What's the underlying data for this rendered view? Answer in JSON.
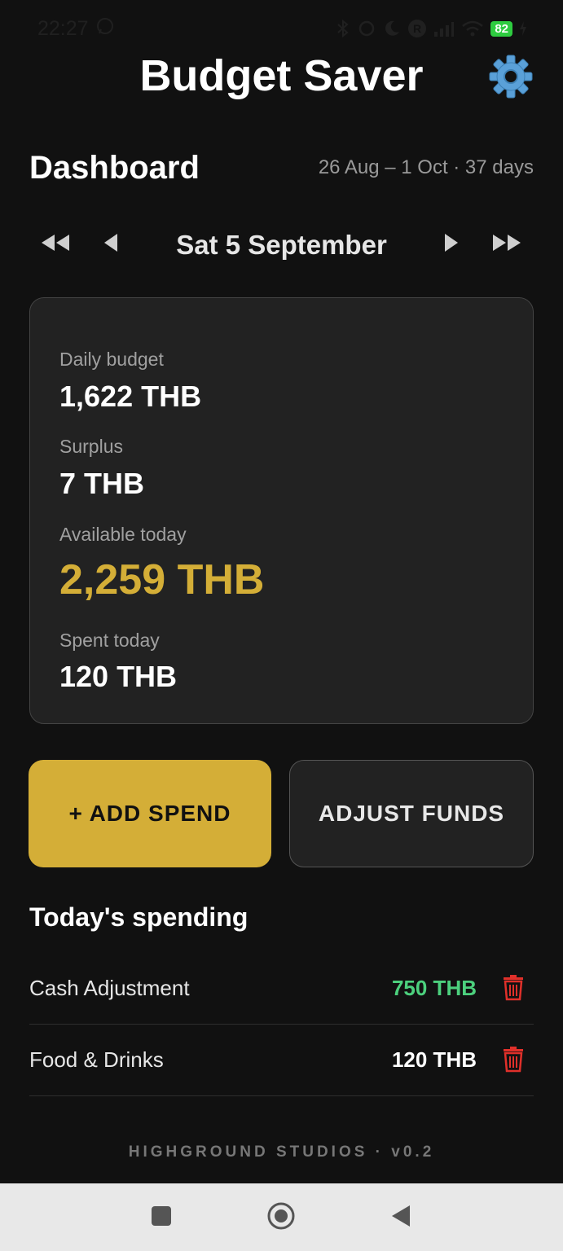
{
  "status_bar": {
    "time": "22:27",
    "battery": "82",
    "icons": [
      "whatsapp-icon",
      "bluetooth-icon",
      "link-icon",
      "moon-icon",
      "r-icon",
      "signal-icon",
      "wifi-icon",
      "charging-icon"
    ]
  },
  "header": {
    "title": "Budget Saver",
    "settings_icon": "gear-icon"
  },
  "dashboard": {
    "title": "Dashboard",
    "date_range": "26 Aug – 1 Oct · 37 days"
  },
  "date_nav": {
    "current_date": "Sat 5 September",
    "icons": [
      "double-chevron-left-icon",
      "chevron-left-icon",
      "chevron-right-icon",
      "double-chevron-right-icon"
    ]
  },
  "summary": {
    "daily_budget_label": "Daily budget",
    "daily_budget_value": "1,622 THB",
    "surplus_label": "Surplus",
    "surplus_value": "7 THB",
    "available_label": "Available today",
    "available_value": "2,259 THB",
    "spent_label": "Spent today",
    "spent_value": "120 THB"
  },
  "actions": {
    "add_spend": "+ ADD SPEND",
    "adjust_funds": "ADJUST FUNDS"
  },
  "spending": {
    "title": "Today's spending",
    "items": [
      {
        "name": "Cash Adjustment",
        "amount": "750 THB",
        "type": "positive"
      },
      {
        "name": "Food & Drinks",
        "amount": "120 THB",
        "type": "normal"
      }
    ]
  },
  "footer": {
    "text": "HIGHGROUND STUDIOS · v0.2"
  },
  "colors": {
    "accent": "#d4ae37",
    "positive": "#4cd07d",
    "delete": "#e0302a",
    "background": "#111111",
    "card": "#222222"
  }
}
